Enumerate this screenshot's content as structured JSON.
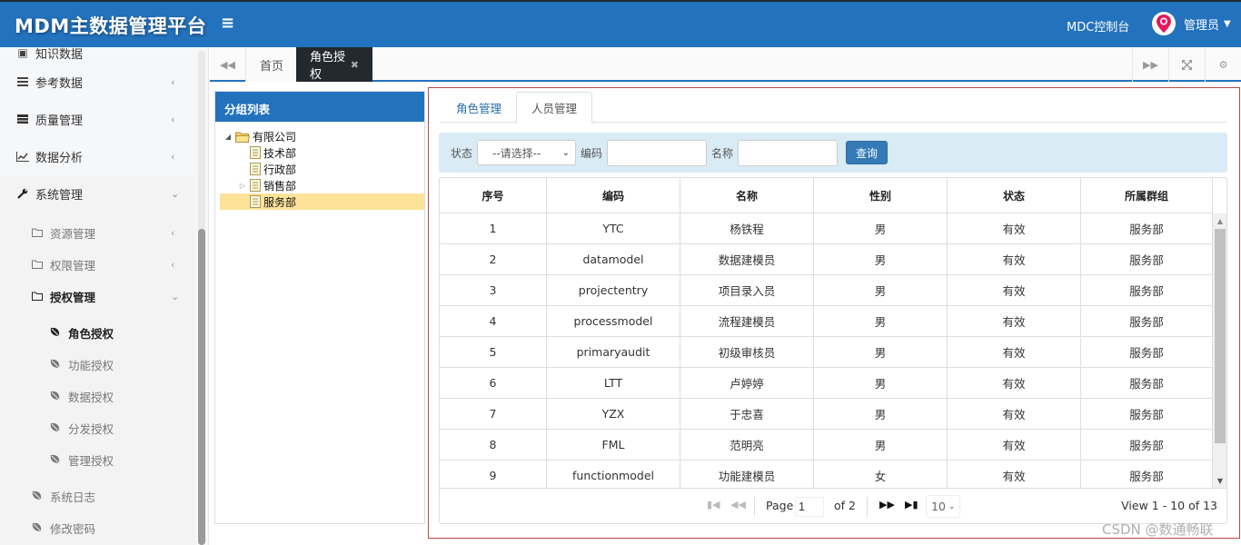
{
  "header": {
    "app_title": "MDM主数据管理平台",
    "menu_toggle_icon": "hamburger-icon",
    "console_link": "MDC控制台",
    "user_name": "管理员",
    "avatar_icon": "map-pin-icon"
  },
  "sidebar": {
    "items": [
      {
        "label": "知识数据",
        "icon": "file-icon",
        "arrow": "‹",
        "clipped": true
      },
      {
        "label": "参考数据",
        "icon": "list-icon",
        "arrow": "‹"
      },
      {
        "label": "质量管理",
        "icon": "server-icon",
        "arrow": "‹"
      },
      {
        "label": "数据分析",
        "icon": "line-chart-icon",
        "arrow": "‹"
      },
      {
        "label": "系统管理",
        "icon": "wrench-icon",
        "arrow": "⌄",
        "expanded": true
      }
    ],
    "system_children": [
      {
        "label": "资源管理",
        "icon": "folder-icon",
        "arrow": "‹"
      },
      {
        "label": "权限管理",
        "icon": "folder-icon",
        "arrow": "‹"
      },
      {
        "label": "授权管理",
        "icon": "folder-icon",
        "arrow": "⌄",
        "expanded": true
      }
    ],
    "auth_children": [
      {
        "label": "角色授权",
        "icon": "leaf-icon",
        "active": true
      },
      {
        "label": "功能授权",
        "icon": "leaf-icon"
      },
      {
        "label": "数据授权",
        "icon": "leaf-icon"
      },
      {
        "label": "分发授权",
        "icon": "leaf-icon"
      },
      {
        "label": "管理授权",
        "icon": "leaf-icon"
      }
    ],
    "bottom_items": [
      {
        "label": "系统日志",
        "icon": "leaf-icon"
      },
      {
        "label": "修改密码",
        "icon": "leaf-icon"
      }
    ]
  },
  "tabbar": {
    "tabs": [
      {
        "label": "首页"
      },
      {
        "label": "角色授权",
        "active": true,
        "close": "✖"
      }
    ],
    "left_icon": "double-left-icon",
    "right_icons": [
      "double-right-icon",
      "fullscreen-icon",
      "gear-icon"
    ]
  },
  "group_panel": {
    "title": "分组列表",
    "tree": [
      {
        "label": "有限公司",
        "level": 0,
        "toggle": "◢",
        "icon": "folder-open-icon"
      },
      {
        "label": "技术部",
        "level": 1,
        "toggle": "",
        "icon": "document-icon"
      },
      {
        "label": "行政部",
        "level": 1,
        "toggle": "",
        "icon": "document-icon"
      },
      {
        "label": "销售部",
        "level": 1,
        "toggle": "▷",
        "icon": "document-icon"
      },
      {
        "label": "服务部",
        "level": 1,
        "toggle": "",
        "icon": "document-icon",
        "selected": true
      }
    ]
  },
  "main": {
    "subtabs": [
      {
        "label": "角色管理"
      },
      {
        "label": "人员管理",
        "active": true
      }
    ],
    "search": {
      "status_label": "状态",
      "status_value": "--请选择--",
      "code_label": "编码",
      "code_value": "",
      "name_label": "名称",
      "name_value": "",
      "query_button": "查询"
    },
    "grid": {
      "columns": [
        "序号",
        "编码",
        "名称",
        "性别",
        "状态",
        "所属群组"
      ],
      "rows": [
        [
          "1",
          "YTC",
          "杨铁程",
          "男",
          "有效",
          "服务部"
        ],
        [
          "2",
          "datamodel",
          "数据建模员",
          "男",
          "有效",
          "服务部"
        ],
        [
          "3",
          "projectentry",
          "项目录入员",
          "男",
          "有效",
          "服务部"
        ],
        [
          "4",
          "processmodel",
          "流程建模员",
          "男",
          "有效",
          "服务部"
        ],
        [
          "5",
          "primaryaudit",
          "初级审核员",
          "男",
          "有效",
          "服务部"
        ],
        [
          "6",
          "LTT",
          "卢婷婷",
          "男",
          "有效",
          "服务部"
        ],
        [
          "7",
          "YZX",
          "于忠喜",
          "男",
          "有效",
          "服务部"
        ],
        [
          "8",
          "FML",
          "范明亮",
          "男",
          "有效",
          "服务部"
        ],
        [
          "9",
          "functionmodel",
          "功能建模员",
          "女",
          "有效",
          "服务部"
        ]
      ]
    },
    "pager": {
      "page_label": "Page",
      "page_value": "1",
      "of_label": "of 2",
      "page_size": "10",
      "view_text": "View 1 - 10 of 13"
    }
  },
  "watermark": "CSDN @数通畅联",
  "colors": {
    "header_bg": "#2372bd",
    "active_tab_bg": "#23292e",
    "selected_tree_bg": "#fde39a",
    "search_bar_bg": "#d9ebf5",
    "query_button_bg": "#337ab7",
    "highlight_border": "#b94a48"
  }
}
